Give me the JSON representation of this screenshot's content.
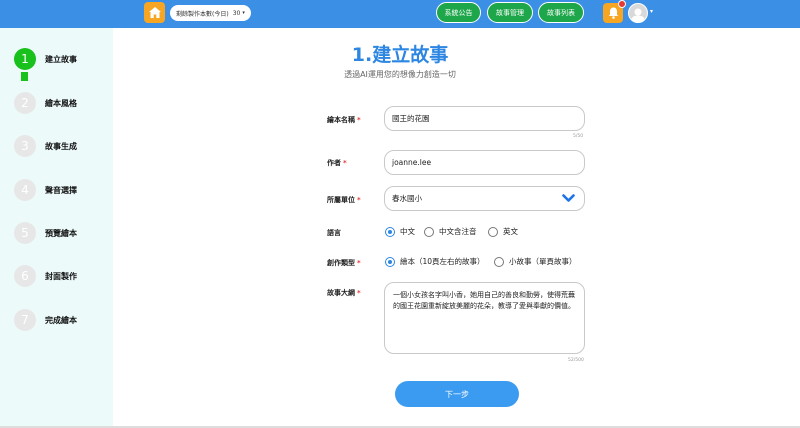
{
  "header": {
    "quota_label": "剩餘製作本數(今日)",
    "quota_value": "30",
    "nav": [
      "系統公告",
      "故事管理",
      "故事列表"
    ]
  },
  "steps": [
    {
      "num": "1",
      "label": "建立故事"
    },
    {
      "num": "2",
      "label": "繪本風格"
    },
    {
      "num": "3",
      "label": "故事生成"
    },
    {
      "num": "4",
      "label": "聲音選擇"
    },
    {
      "num": "5",
      "label": "預覽繪本"
    },
    {
      "num": "6",
      "label": "封面製作"
    },
    {
      "num": "7",
      "label": "完成繪本"
    }
  ],
  "page": {
    "title": "1.建立故事",
    "subtitle": "透過AI運用您的想像力創造一切"
  },
  "form": {
    "name_label": "繪本名稱",
    "name_value": "國王的花園",
    "name_counter": "5/50",
    "author_label": "作者",
    "author_value": "joanne.lee",
    "unit_label": "所屬單位",
    "unit_value": "春水國小",
    "lang_label": "語言",
    "lang_options": [
      "中文",
      "中文含注音",
      "英文"
    ],
    "type_label": "創作類型",
    "type_options": [
      "繪本（10頁左右的故事）",
      "小故事（單頁故事）"
    ],
    "outline_label": "故事大綱",
    "outline_value": "一個小女孩名字叫小香，她用自己的善良和勤勞，使得荒蕪的國王花園重新綻放美麗的花朵，教導了愛與奉獻的價值。",
    "outline_counter": "52/500",
    "required_mark": "*"
  },
  "next_label": "下一步",
  "colors": {
    "accent": "#2d87e2",
    "topbar": "#3b8fe4",
    "nav_green": "#1ea64a",
    "step_active": "#19c11c",
    "orange": "#f6a623"
  }
}
